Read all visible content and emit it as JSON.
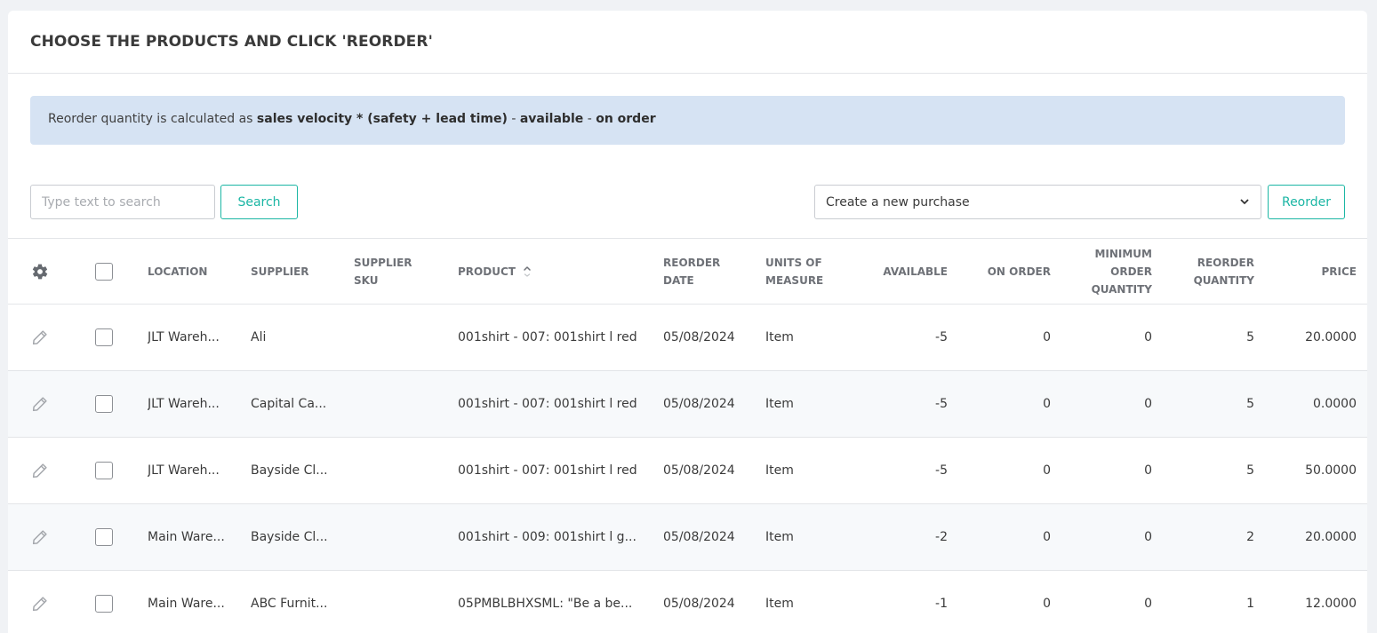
{
  "page": {
    "title": "CHOOSE THE PRODUCTS AND CLICK 'REORDER'"
  },
  "info": {
    "prefix": "Reorder quantity is calculated as ",
    "formula_1": "sales velocity * (safety + lead time)",
    "sep_1": " - ",
    "formula_2": "available",
    "sep_2": " - ",
    "formula_3": "on order"
  },
  "toolbar": {
    "search_placeholder": "Type text to search",
    "search_label": "Search",
    "purchase_select_value": "Create a new purchase",
    "reorder_label": "Reorder"
  },
  "table": {
    "headers": {
      "location": "LOCATION",
      "supplier": "SUPPLIER",
      "supplier_sku_1": "SUPPLIER",
      "supplier_sku_2": "SKU",
      "product": "PRODUCT",
      "reorder_date_1": "REORDER",
      "reorder_date_2": "DATE",
      "units_1": "UNITS OF",
      "units_2": "MEASURE",
      "available": "AVAILABLE",
      "on_order": "ON ORDER",
      "min_qty_1": "MINIMUM",
      "min_qty_2": "ORDER",
      "min_qty_3": "QUANTITY",
      "reorder_qty_1": "REORDER",
      "reorder_qty_2": "QUANTITY",
      "price": "PRICE"
    },
    "rows": [
      {
        "location": "JLT Wareh...",
        "supplier": "Ali",
        "supplier_sku": "",
        "product": "001shirt - 007: 001shirt l red",
        "reorder_date": "05/08/2024",
        "units": "Item",
        "available": "-5",
        "on_order": "0",
        "min_qty": "0",
        "reorder_qty": "5",
        "price": "20.0000"
      },
      {
        "location": "JLT Wareh...",
        "supplier": "Capital Ca...",
        "supplier_sku": "",
        "product": "001shirt - 007: 001shirt l red",
        "reorder_date": "05/08/2024",
        "units": "Item",
        "available": "-5",
        "on_order": "0",
        "min_qty": "0",
        "reorder_qty": "5",
        "price": "0.0000"
      },
      {
        "location": "JLT Wareh...",
        "supplier": "Bayside Cl...",
        "supplier_sku": "",
        "product": "001shirt - 007: 001shirt l red",
        "reorder_date": "05/08/2024",
        "units": "Item",
        "available": "-5",
        "on_order": "0",
        "min_qty": "0",
        "reorder_qty": "5",
        "price": "50.0000"
      },
      {
        "location": "Main Ware...",
        "supplier": "Bayside Cl...",
        "supplier_sku": "",
        "product": "001shirt - 009: 001shirt l g...",
        "reorder_date": "05/08/2024",
        "units": "Item",
        "available": "-2",
        "on_order": "0",
        "min_qty": "0",
        "reorder_qty": "2",
        "price": "20.0000"
      },
      {
        "location": "Main Ware...",
        "supplier": "ABC Furnit...",
        "supplier_sku": "",
        "product": "05PMBLBHXSML: \"Be a be...",
        "reorder_date": "05/08/2024",
        "units": "Item",
        "available": "-1",
        "on_order": "0",
        "min_qty": "0",
        "reorder_qty": "1",
        "price": "12.0000"
      }
    ]
  },
  "colors": {
    "accent": "#1bb6a4",
    "info_bg": "#d6e3f3",
    "page_bg": "#f0f2f5"
  },
  "icons": {
    "settings": "gear-icon",
    "edit": "pencil-icon",
    "sort": "sort-icon",
    "dropdown": "chevron-down-icon"
  }
}
